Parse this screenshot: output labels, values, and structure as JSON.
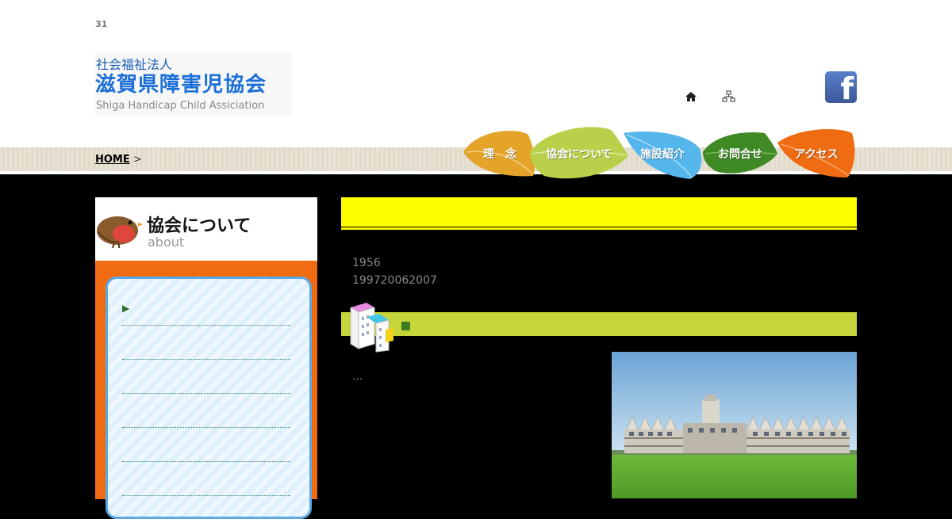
{
  "page_number": "31",
  "logo": {
    "line1": "社会福祉法人",
    "line2": "滋賀県障害児協会",
    "line3": "Shiga Handicap Child Assiciation"
  },
  "header_icons": [
    "home-icon",
    "sitemap-icon",
    "facebook-icon"
  ],
  "breadcrumb": {
    "home": "HOME",
    "separator": ">"
  },
  "nav": [
    {
      "label": "理　念",
      "color": "#e4a42a"
    },
    {
      "label": "協会について",
      "color": "#b9d14a"
    },
    {
      "label": "施設紹介",
      "color": "#55b6ec"
    },
    {
      "label": "お問合せ",
      "color": "#3f8a25"
    },
    {
      "label": "アクセス",
      "color": "#ef6c12"
    }
  ],
  "sidebar": {
    "title": "協会について",
    "subtitle": "about",
    "arrow": "▶"
  },
  "content": {
    "line1": "1956",
    "line2": "199720062007",
    "ellipsis": "…"
  },
  "colors": {
    "accent_orange": "#ef6c12",
    "yellow_bar": "#ffff00",
    "green_bar": "#c5d63a",
    "facebook": "#3b5998"
  }
}
